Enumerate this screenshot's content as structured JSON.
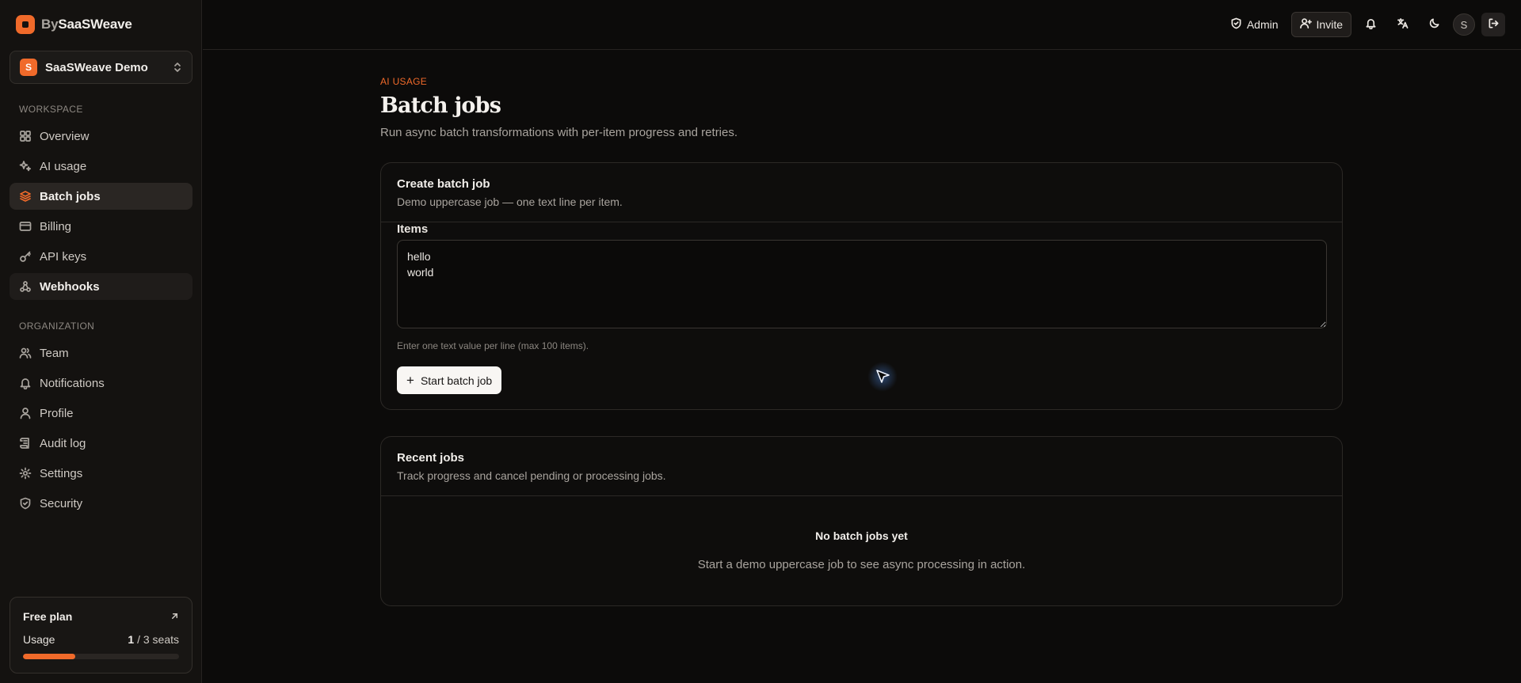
{
  "brand": {
    "prefix": "By",
    "name": "SaaSWeave"
  },
  "org": {
    "initial": "S",
    "name": "SaaSWeave Demo"
  },
  "sidebar": {
    "workspace_label": "WORKSPACE",
    "workspace_items": [
      {
        "label": "Overview",
        "icon": "grid-icon"
      },
      {
        "label": "AI usage",
        "icon": "sparkles-icon"
      },
      {
        "label": "Batch jobs",
        "icon": "layers-icon",
        "state": "active"
      },
      {
        "label": "Billing",
        "icon": "credit-card-icon"
      },
      {
        "label": "API keys",
        "icon": "key-icon"
      },
      {
        "label": "Webhooks",
        "icon": "webhook-icon",
        "state": "hover"
      }
    ],
    "organization_label": "ORGANIZATION",
    "organization_items": [
      {
        "label": "Team",
        "icon": "users-icon"
      },
      {
        "label": "Notifications",
        "icon": "bell-icon"
      },
      {
        "label": "Profile",
        "icon": "user-icon"
      },
      {
        "label": "Audit log",
        "icon": "scroll-icon"
      },
      {
        "label": "Settings",
        "icon": "gear-icon"
      },
      {
        "label": "Security",
        "icon": "shield-icon"
      }
    ]
  },
  "plan": {
    "title": "Free plan",
    "usage_label": "Usage",
    "seats_used": "1",
    "seats_rest": "/ 3 seats",
    "usage_fraction": 0.333,
    "accent": "#f06a2a"
  },
  "header": {
    "admin_label": "Admin",
    "invite_label": "Invite",
    "avatar_initial": "S"
  },
  "page": {
    "eyebrow": "AI USAGE",
    "title": "Batch jobs",
    "subtitle": "Run async batch transformations with per-item progress and retries."
  },
  "create_card": {
    "title": "Create batch job",
    "description": "Demo uppercase job — one text line per item.",
    "items_label": "Items",
    "items_value": "hello\nworld",
    "hint": "Enter one text value per line (max 100 items).",
    "start_label": "Start batch job"
  },
  "recent_card": {
    "title": "Recent jobs",
    "description": "Track progress and cancel pending or processing jobs.",
    "empty_title": "No batch jobs yet",
    "empty_desc": "Start a demo uppercase job to see async processing in action."
  }
}
